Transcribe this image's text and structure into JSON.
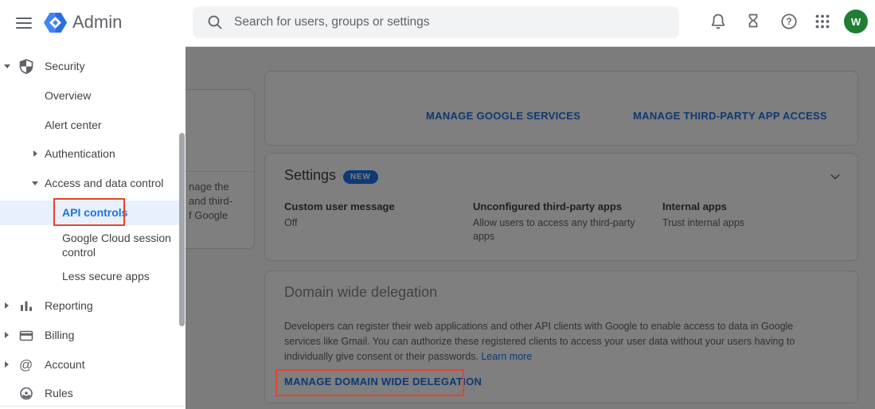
{
  "header": {
    "app_title": "Admin",
    "search_placeholder": "Search for users, groups or settings",
    "avatar_initial": "W"
  },
  "sidebar": {
    "items": [
      {
        "label": "Security"
      },
      {
        "label": "Overview"
      },
      {
        "label": "Alert center"
      },
      {
        "label": "Authentication"
      },
      {
        "label": "Access and data control"
      },
      {
        "label": "API controls"
      },
      {
        "label": "Google Cloud session control"
      },
      {
        "label": "Less secure apps"
      },
      {
        "label": "Reporting"
      },
      {
        "label": "Billing"
      },
      {
        "label": "Account"
      },
      {
        "label": "Rules"
      }
    ]
  },
  "content": {
    "partial_card_lines": [
      "nage the",
      "and third-",
      "f Google"
    ],
    "top_card": {
      "links": [
        "MANAGE GOOGLE SERVICES",
        "MANAGE THIRD-PARTY APP ACCESS"
      ]
    },
    "settings": {
      "title": "Settings",
      "badge": "NEW",
      "columns": [
        {
          "title": "Custom user message",
          "value": "Off"
        },
        {
          "title": "Unconfigured third-party apps",
          "value": "Allow users to access any third-party apps"
        },
        {
          "title": "Internal apps",
          "value": "Trust internal apps"
        }
      ]
    },
    "domain": {
      "title": "Domain wide delegation",
      "line1": "Developers can register their web applications and other API clients with Google to enable access to data in Google",
      "line2": "services like Gmail. You can authorize these registered clients to access your user data without your users having to",
      "line3": "individually give consent or their passwords.",
      "learn_more": "Learn more",
      "cta": "MANAGE DOMAIN WIDE DELEGATION"
    }
  },
  "colors": {
    "accent_blue": "#1a73e8",
    "highlight_blue_bg": "#e8f0fe",
    "annotation_red": "#e8432a",
    "avatar_green": "#1e7e34",
    "badge_blue": "#1a73e8"
  }
}
